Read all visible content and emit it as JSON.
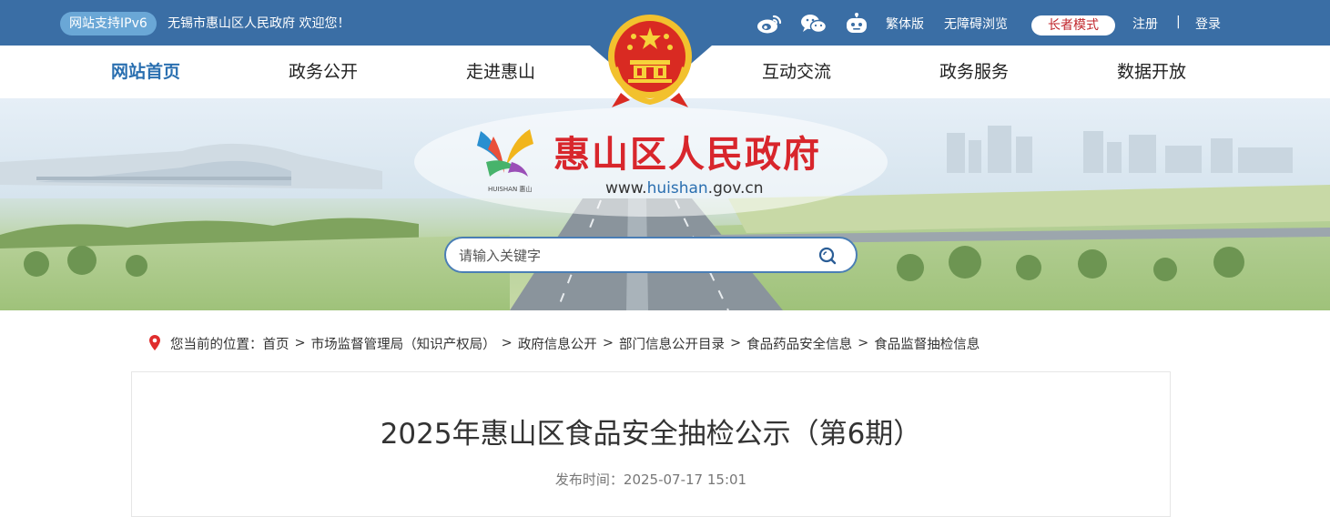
{
  "topbar": {
    "ipv6_badge": "网站支持IPv6",
    "welcome": "无锡市惠山区人民政府 欢迎您！",
    "icons": [
      "weibo-icon",
      "wechat-icon",
      "robot-icon"
    ],
    "links": {
      "traditional": "繁体版",
      "accessible": "无障碍浏览",
      "elder_mode": "长者模式",
      "register": "注册",
      "separator": "|",
      "login": "登录"
    }
  },
  "nav": {
    "items": [
      {
        "label": "网站首页",
        "active": true
      },
      {
        "label": "政务公开",
        "active": false
      },
      {
        "label": "走进惠山",
        "active": false
      },
      {
        "label": "互动交流",
        "active": false
      },
      {
        "label": "政务服务",
        "active": false
      },
      {
        "label": "数据开放",
        "active": false
      }
    ]
  },
  "banner": {
    "logo_caption": "HUISHAN 惠山",
    "site_title": "惠山区人民政府",
    "url_prefix": "www.",
    "url_highlight": "huishan",
    "url_suffix": ".gov.cn",
    "search_placeholder": "请输入关键字"
  },
  "breadcrumb": {
    "prefix": "您当前的位置：",
    "items": [
      "首页",
      "市场监督管理局（知识产权局）",
      "政府信息公开",
      "部门信息公开目录",
      "食品药品安全信息",
      "食品监督抽检信息"
    ],
    "separator": ">"
  },
  "article": {
    "title": "2025年惠山区食品安全抽检公示（第6期）",
    "publish_label": "发布时间：",
    "publish_time": "2025-07-17 15:01"
  },
  "colors": {
    "topbar": "#3a6ea5",
    "brand_red": "#d8262c",
    "brand_blue": "#2a6fb0"
  }
}
